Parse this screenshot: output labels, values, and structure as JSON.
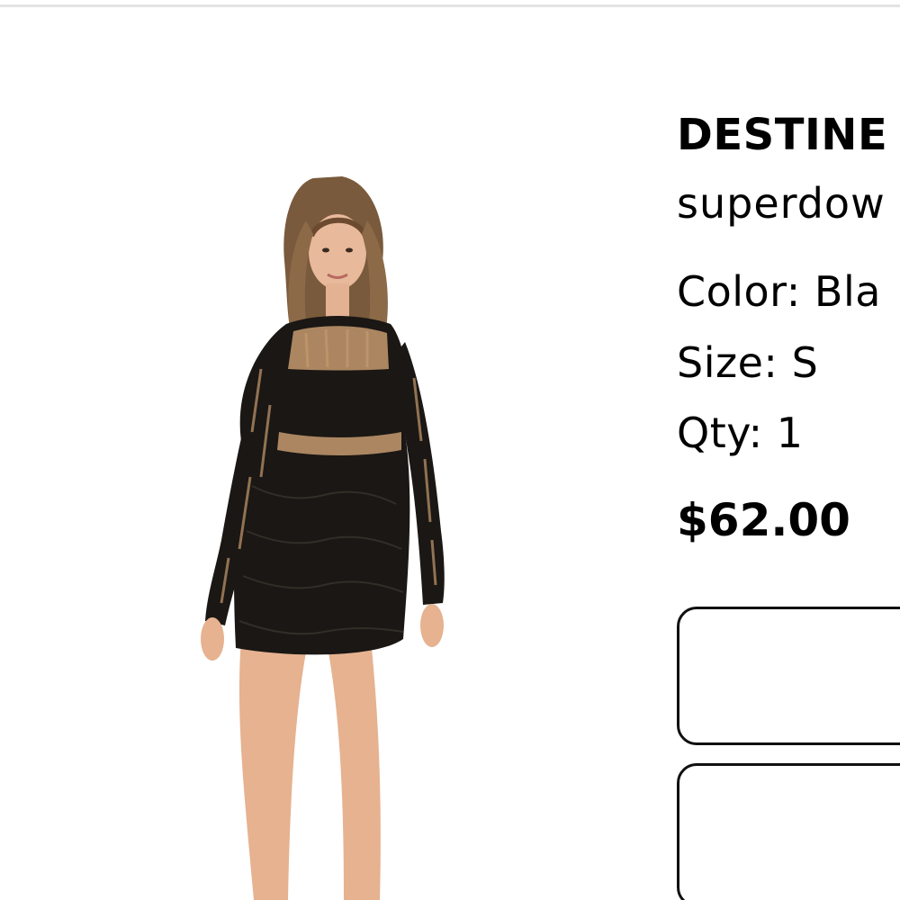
{
  "product": {
    "name": "DESTINE",
    "designer": "superdow",
    "color_label": "Color:",
    "color_value": "Bla",
    "size_label": "Size:",
    "size_value": "S",
    "qty_label": "Qty:",
    "qty_value": "1",
    "price": "$62.00",
    "image_icon": "product-photo-dress",
    "accent_color": "#000000"
  }
}
